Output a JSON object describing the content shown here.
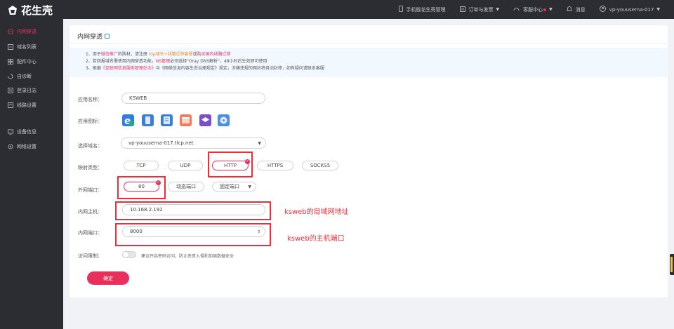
{
  "header": {
    "logo_text": "花生壳",
    "nav": [
      {
        "label": "手机版花生壳管理",
        "icon": "phone-icon"
      },
      {
        "label": "订单与发票",
        "icon": "order-icon"
      },
      {
        "label": "客服中心",
        "icon": "headset-icon"
      },
      {
        "label": "消息",
        "icon": "bell-icon"
      },
      {
        "label": "vp-youuserna-017",
        "icon": "user-icon"
      }
    ]
  },
  "sidebar": {
    "items": [
      {
        "label": "内网穿透",
        "icon": "globe-icon",
        "active": true
      },
      {
        "label": "域名列表",
        "icon": "list-icon"
      },
      {
        "label": "配件中心",
        "icon": "grid-icon"
      },
      {
        "label": "自诊断",
        "icon": "diagnose-icon"
      },
      {
        "label": "登录日志",
        "icon": "log-icon"
      },
      {
        "label": "线路设置",
        "icon": "route-icon"
      },
      {
        "label": "设备信息",
        "icon": "device-icon"
      },
      {
        "label": "网络设置",
        "icon": "network-icon"
      }
    ]
  },
  "main": {
    "title": "内网穿透",
    "notice": {
      "line1_a": "1、用于",
      "line1_b": "微信推广",
      "line1_c": "的购材，请注册 ",
      "line1_d": "top域名+线路迁移套餐",
      "line1_e": "或",
      "line1_f": "购买国内线路迁移",
      "line2_a": "2、若回报域名需使用内网穿透功能，",
      "line2_b": "NS管理",
      "line2_c": "必须选择\"Oray DNS解析\"，48小时后生效即可使用",
      "line3_a": "3、根据",
      "line3_b": "《互联网信息服务管理办法》",
      "line3_c": "与《网络信息内容生态治理规定》规定，涉嫌违规的网站将自动封停，如有疑问请联系客服"
    },
    "form": {
      "app_name_label": "应用名称：",
      "app_name_value": "KSWEB",
      "app_icon_label": "应用图标：",
      "domain_label": "选择域名：",
      "domain_value": "vp-youuserna-017.tlcp.net",
      "map_type_label": "映射类型：",
      "map_types": [
        "TCP",
        "UDP",
        "HTTP",
        "HTTPS",
        "SOCKS5"
      ],
      "map_type_selected": "HTTP",
      "ext_port_label": "外网端口：",
      "ext_port_value": "80",
      "dynamic_port": "动态端口",
      "fixed_port": "固定端口",
      "int_host_label": "内网主机：",
      "int_host_value": "10.168.2.192",
      "int_port_label": "内网端口：",
      "int_port_value": "8000",
      "access_label": "访问限制：",
      "access_hint": "建议开启密码访问，防止恶意入侵和加强数据安全",
      "confirm_label": "确定"
    },
    "annotations": {
      "host_note": "ksweb的局域网地址",
      "port_note": "ksweb的主机端口"
    }
  },
  "colors": {
    "accent": "#e8305b",
    "sidebar_bg": "#2b2d33",
    "annotation": "#e8303b"
  }
}
